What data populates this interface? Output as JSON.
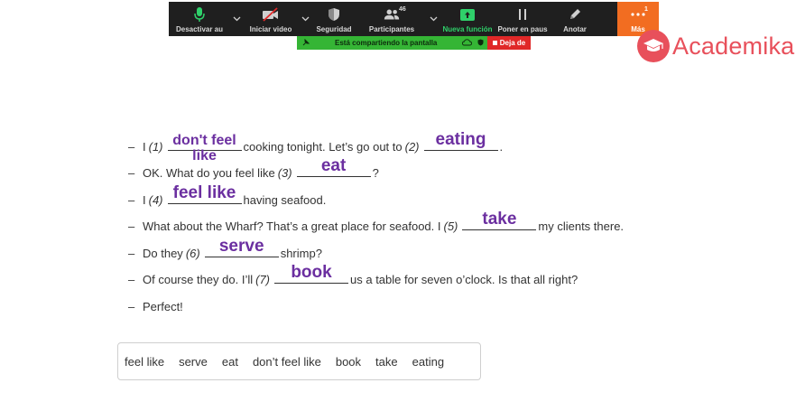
{
  "toolbar": {
    "mute": "Desactivar au",
    "video": "Iniciar video",
    "security": "Seguridad",
    "participants": "Participantes",
    "participants_count": "46",
    "new_feature": "Nueva función",
    "pause": "Poner en paus",
    "annotate": "Anotar",
    "more": "Más",
    "more_badge": "1"
  },
  "share_bar": {
    "status": "Está compartiendo la pantalla",
    "stop": "Deja de"
  },
  "logo": {
    "text": "Academika"
  },
  "exercise": {
    "lines": [
      {
        "pre": "I",
        "num": "(1)",
        "answer_l1": "don't feel",
        "answer_l2": "like",
        "post": "cooking tonight. Let’s go out to",
        "num2": "(2)",
        "answer2": "eating",
        "post2": "."
      },
      {
        "pre": "OK. What do you feel like",
        "num": "(3)",
        "answer": "eat",
        "post": "?"
      },
      {
        "pre": "I",
        "num": "(4)",
        "answer": "feel like",
        "post": "having seafood."
      },
      {
        "pre": "What about the Wharf? That’s a great place for seafood. I",
        "num": "(5)",
        "answer": "take",
        "post": "my clients there."
      },
      {
        "pre": "Do they",
        "num": "(6)",
        "answer": "serve",
        "post": "shrimp?"
      },
      {
        "pre": "Of course they do. I’ll",
        "num": "(7)",
        "answer": "book",
        "post": "us a table for seven o’clock. Is that all right?"
      },
      {
        "pre": "Perfect!"
      }
    ],
    "dash": "–"
  },
  "word_bank": [
    "feel like",
    "serve",
    "eat",
    "don’t feel like",
    "book",
    "take",
    "eating"
  ],
  "colors": {
    "answer": "#6b2fa0",
    "toolbar": "#1f1f1f",
    "more": "#f26d21",
    "share": "#35b535",
    "stop": "#e02828",
    "logo": "#e8505b"
  }
}
